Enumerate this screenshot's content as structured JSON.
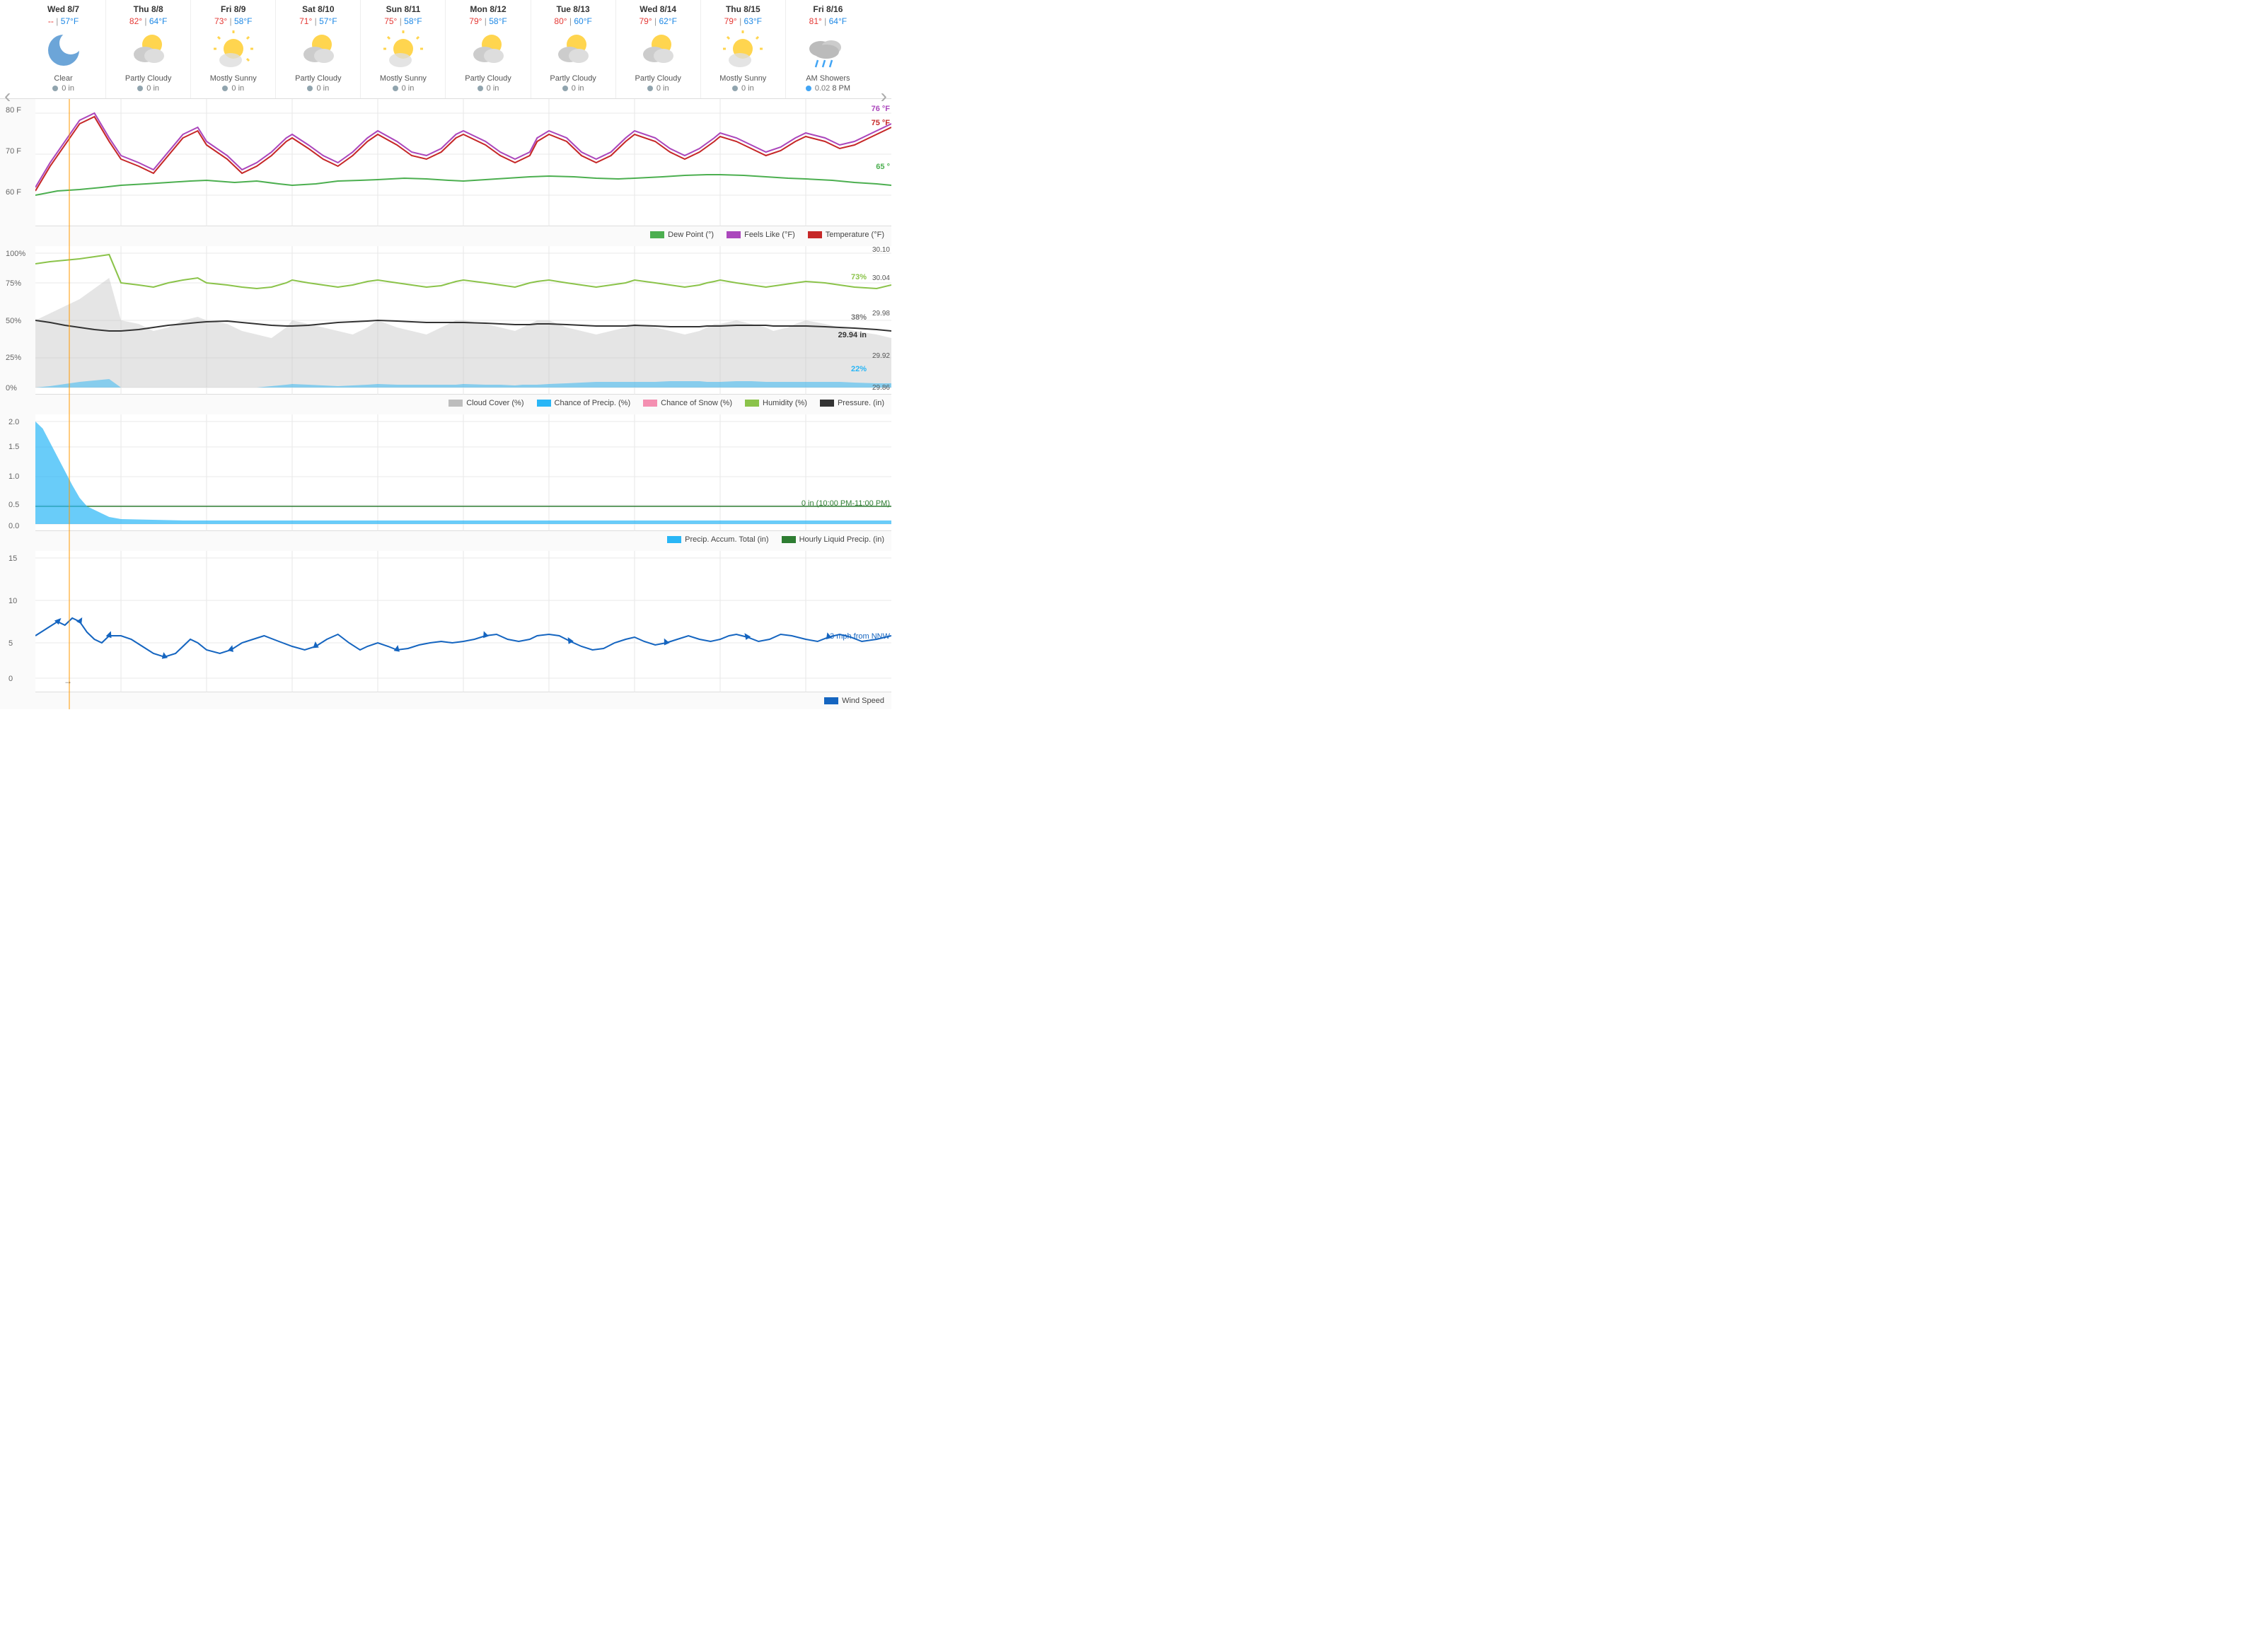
{
  "nav": {
    "left_arrow": "‹",
    "right_arrow": "›"
  },
  "days": [
    {
      "label": "Wed 8/7",
      "hi": "--",
      "lo": "57°F",
      "condition": "Clear",
      "precip": "0 in",
      "icon_type": "clear_night"
    },
    {
      "label": "Thu 8/8",
      "hi": "82°",
      "lo": "64°F",
      "condition": "Partly Cloudy",
      "precip": "0 in",
      "icon_type": "partly_cloudy"
    },
    {
      "label": "Fri 8/9",
      "hi": "73°",
      "lo": "58°F",
      "condition": "Mostly Sunny",
      "precip": "0 in",
      "icon_type": "mostly_sunny"
    },
    {
      "label": "Sat 8/10",
      "hi": "71°",
      "lo": "57°F",
      "condition": "Partly Cloudy",
      "precip": "0 in",
      "icon_type": "partly_cloudy"
    },
    {
      "label": "Sun 8/11",
      "hi": "75°",
      "lo": "58°F",
      "condition": "Mostly Sunny",
      "precip": "0 in",
      "icon_type": "mostly_sunny"
    },
    {
      "label": "Mon 8/12",
      "hi": "79°",
      "lo": "58°F",
      "condition": "Partly Cloudy",
      "precip": "0 in",
      "icon_type": "partly_cloudy"
    },
    {
      "label": "Tue 8/13",
      "hi": "80°",
      "lo": "60°F",
      "condition": "Partly Cloudy",
      "precip": "0 in",
      "icon_type": "partly_cloudy"
    },
    {
      "label": "Wed 8/14",
      "hi": "79°",
      "lo": "62°F",
      "condition": "Partly Cloudy",
      "precip": "0 in",
      "icon_type": "partly_cloudy"
    },
    {
      "label": "Thu 8/15",
      "hi": "79°",
      "lo": "63°F",
      "condition": "Mostly Sunny",
      "precip": "0 in",
      "icon_type": "mostly_sunny"
    },
    {
      "label": "Fri 8/16",
      "hi": "81°",
      "lo": "64°F",
      "condition": "AM Showers",
      "precip": "0.02",
      "precip_time": "8 PM",
      "icon_type": "am_showers"
    }
  ],
  "temp_chart": {
    "y_labels": [
      "80 F",
      "70 F",
      "60 F"
    ],
    "values": {
      "temp_76": "76 °F",
      "temp_75": "75 °F",
      "temp_65": "65 °"
    },
    "legend": [
      {
        "label": "Dew Point (°)",
        "color": "#4caf50"
      },
      {
        "label": "Feels Like (°F)",
        "color": "#ab47bc"
      },
      {
        "label": "Temperature (°F)",
        "color": "#c62828"
      }
    ]
  },
  "conditions_chart": {
    "y_labels": [
      "100%",
      "75%",
      "50%",
      "25%",
      "0%"
    ],
    "values": {
      "humidity": "73%",
      "cloud_cover": "38%",
      "pressure": "29.94 in",
      "precip_chance": "22%"
    },
    "pressure_labels": [
      "30.10",
      "30.04",
      "29.98",
      "29.92",
      "29.86"
    ],
    "legend": [
      {
        "label": "Cloud Cover (%)",
        "color": "#bdbdbd"
      },
      {
        "label": "Chance of Precip. (%)",
        "color": "#29b6f6"
      },
      {
        "label": "Chance of Snow (%)",
        "color": "#f48fb1"
      },
      {
        "label": "Humidity (%)",
        "color": "#8bc34a"
      },
      {
        "label": "Pressure. (in)",
        "color": "#212121"
      }
    ]
  },
  "precip_chart": {
    "y_labels": [
      "2.0",
      "1.5",
      "1.0",
      "0.5",
      "0.0"
    ],
    "value_label": "0 in (10:00 PM-11:00 PM)",
    "legend": [
      {
        "label": "Precip. Accum. Total (in)",
        "color": "#29b6f6"
      },
      {
        "label": "Hourly Liquid Precip. (in)",
        "color": "#2e7d32"
      }
    ]
  },
  "wind_chart": {
    "y_labels": [
      "15",
      "10",
      "5",
      "0"
    ],
    "value_label": "3 mph from NNW",
    "legend": [
      {
        "label": "Wind Speed",
        "color": "#1565c0"
      }
    ]
  }
}
